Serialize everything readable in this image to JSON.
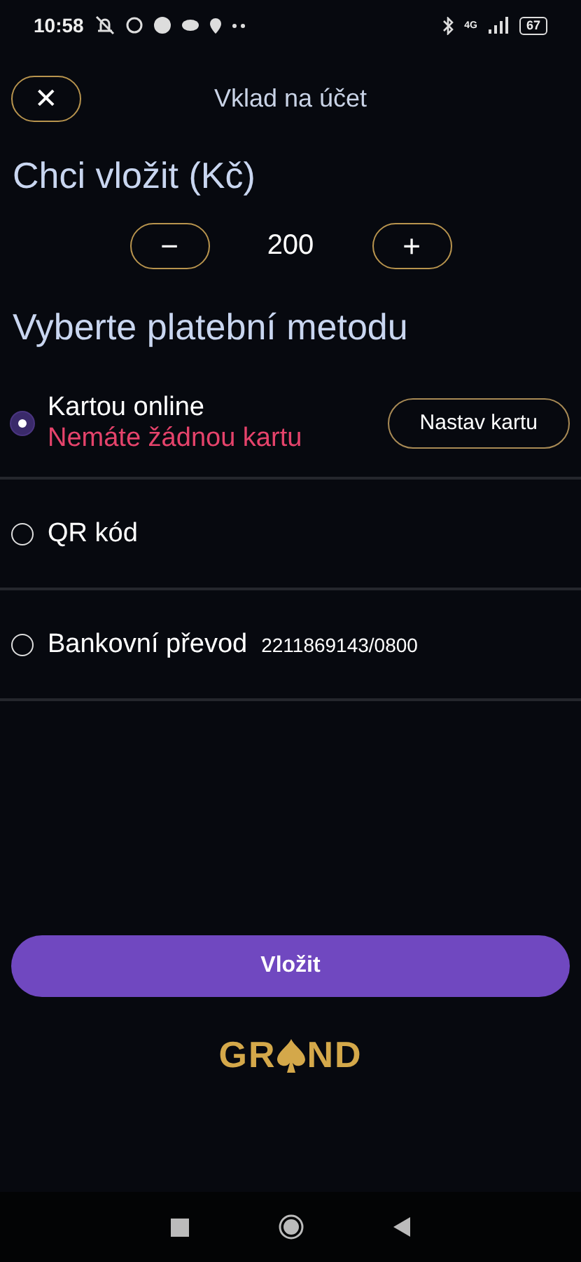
{
  "status_bar": {
    "time": "10:58",
    "network": "4G",
    "battery": "67"
  },
  "header": {
    "close_label": "✕",
    "title": "Vklad na účet"
  },
  "amount": {
    "heading": "Chci vložit (Kč)",
    "minus": "−",
    "value": "200",
    "plus": "+"
  },
  "methods_heading": "Vyberte platební metodu",
  "methods": [
    {
      "label": "Kartou online",
      "selected": true,
      "warning": "Nemáte žádnou kartu",
      "action": "Nastav kartu"
    },
    {
      "label": "QR kód",
      "selected": false
    },
    {
      "label": "Bankovní převod",
      "selected": false,
      "detail": "2211869143/0800"
    }
  ],
  "submit": "Vložit",
  "logo": {
    "before": "GR",
    "after": "ND"
  }
}
